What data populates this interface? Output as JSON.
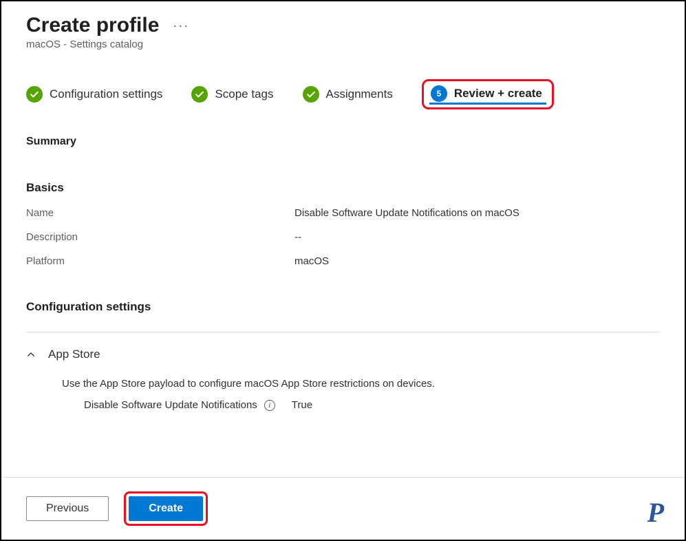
{
  "header": {
    "title": "Create profile",
    "subtitle": "macOS - Settings catalog"
  },
  "steps": [
    {
      "label": "Configuration settings",
      "state": "done"
    },
    {
      "label": "Scope tags",
      "state": "done"
    },
    {
      "label": "Assignments",
      "state": "done"
    },
    {
      "label": "Review + create",
      "state": "active",
      "number": "5"
    }
  ],
  "summary": {
    "heading": "Summary",
    "basics_heading": "Basics",
    "rows": [
      {
        "k": "Name",
        "v": "Disable Software Update Notifications on macOS"
      },
      {
        "k": "Description",
        "v": "--"
      },
      {
        "k": "Platform",
        "v": "macOS"
      }
    ],
    "config_heading": "Configuration settings",
    "group": {
      "title": "App Store",
      "description": "Use the App Store payload to configure macOS App Store restrictions on devices.",
      "setting_label": "Disable Software Update Notifications",
      "setting_value": "True"
    }
  },
  "footer": {
    "previous": "Previous",
    "create": "Create"
  },
  "logo": "P"
}
